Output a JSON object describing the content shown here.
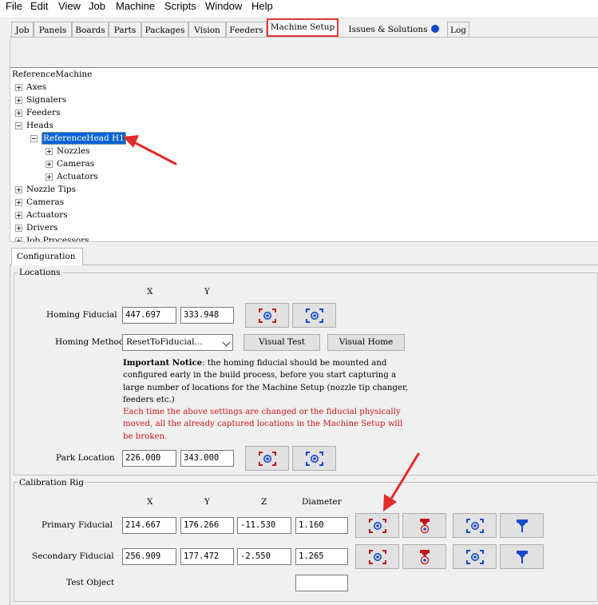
{
  "menu": [
    "File",
    "Edit",
    "View",
    "Job",
    "Machine",
    "Scripts",
    "Window",
    "Help"
  ],
  "tabs": [
    "Job",
    "Panels",
    "Boards",
    "Parts",
    "Packages",
    "Vision",
    "Feeders",
    "Machine Setup",
    "Issues & Solutions",
    "Log"
  ],
  "active_tab": "Machine Setup",
  "colors": {
    "highlight": "#e03a3a",
    "selection": "#0a63d8",
    "warning": "#d01818",
    "icon_red": "#c0181c",
    "icon_blue": "#1449cc"
  },
  "tree": {
    "root": "ReferenceMachine",
    "axes": "Axes",
    "signalers": "Signalers",
    "feeders": "Feeders",
    "heads": "Heads",
    "head_selected": "ReferenceHead H1",
    "nozzles": "Nozzles",
    "cameras_sub": "Cameras",
    "actuators_sub": "Actuators",
    "nozzle_tips": "Nozzle Tips",
    "cameras": "Cameras",
    "actuators": "Actuators",
    "drivers": "Drivers",
    "job_processors": "Job Processors"
  },
  "config_tab": "Configuration",
  "locations": {
    "title": "Locations",
    "x_header": "X",
    "y_header": "Y",
    "homing_fiducial_label": "Homing Fiducial",
    "homing_x": "447.697",
    "homing_y": "333.948",
    "homing_method_label": "Homing Method",
    "homing_method_value": "ResetToFiducial...",
    "visual_test_label": "Visual Test",
    "visual_home_label": "Visual Home",
    "notice_bold": "Important Notice",
    "notice_text": ": the homing fiducial should be mounted and configured early in the build process, before you start capturing a large number of locations for the Machine Setup (nozzle tip changer, feeders etc.)",
    "notice_red": "Each time the above settings are changed or the fiducial physically moved, all the already captured locations in the Machine Setup will be broken.",
    "park_location_label": "Park Location",
    "park_x": "226.000",
    "park_y": "343.000"
  },
  "calibration": {
    "title": "Calibration Rig",
    "x_header": "X",
    "y_header": "Y",
    "z_header": "Z",
    "diameter_header": "Diameter",
    "primary_label": "Primary Fiducial",
    "primary_x": "214.667",
    "primary_y": "176.266",
    "primary_z": "-11.530",
    "primary_d": "1.160",
    "secondary_label": "Secondary Fiducial",
    "secondary_x": "256.909",
    "secondary_y": "177.472",
    "secondary_z": "-2.550",
    "secondary_d": "1.265",
    "test_object_label": "Test Object",
    "test_object_value": ""
  }
}
